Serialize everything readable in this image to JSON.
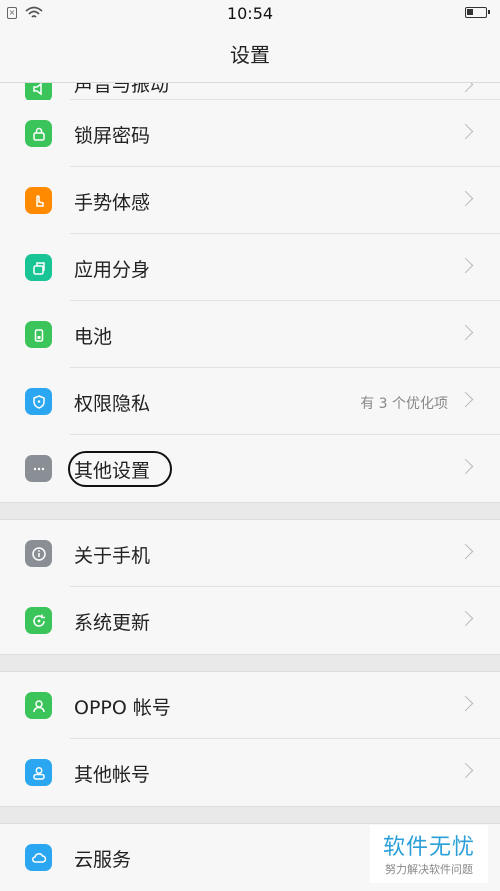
{
  "status_bar": {
    "time": "10:54"
  },
  "header": {
    "title": "设置"
  },
  "groups": [
    {
      "items": [
        {
          "label": "声音与振动",
          "icon": "speaker-icon",
          "color": "#3bc45a"
        },
        {
          "label": "锁屏密码",
          "icon": "lock-icon",
          "color": "#3bc45a"
        },
        {
          "label": "手势体感",
          "icon": "gesture-hand-icon",
          "color": "#ff8a00"
        },
        {
          "label": "应用分身",
          "icon": "clone-app-icon",
          "color": "#19c495"
        },
        {
          "label": "电池",
          "icon": "battery-icon",
          "color": "#3bc45a"
        },
        {
          "label": "权限隐私",
          "icon": "privacy-shield-icon",
          "color": "#2aa7f0",
          "hint": "有 3 个优化项"
        },
        {
          "label": "其他设置",
          "icon": "more-dots-icon",
          "color": "#8a8f96"
        }
      ]
    },
    {
      "items": [
        {
          "label": "关于手机",
          "icon": "info-icon",
          "color": "#8a8f96"
        },
        {
          "label": "系统更新",
          "icon": "update-icon",
          "color": "#3bc45a"
        }
      ]
    },
    {
      "items": [
        {
          "label": "OPPO 帐号",
          "icon": "user-icon",
          "color": "#3bc45a"
        },
        {
          "label": "其他帐号",
          "icon": "accounts-icon",
          "color": "#2aa7f0"
        }
      ]
    },
    {
      "items": [
        {
          "label": "云服务",
          "icon": "cloud-icon",
          "color": "#2aa7f0"
        }
      ]
    }
  ],
  "watermark": {
    "main": "软件无忧",
    "sub": "努力解决软件问题"
  }
}
